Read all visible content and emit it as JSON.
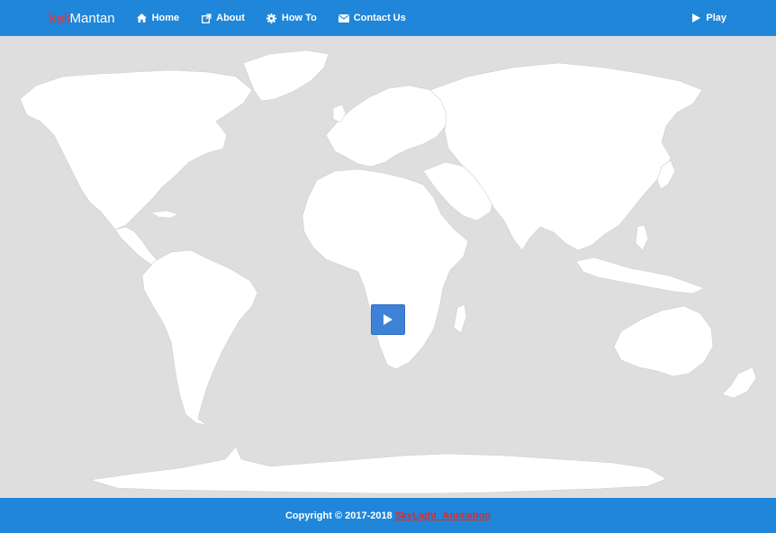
{
  "brand": {
    "accent": "kali",
    "rest": "Mantan"
  },
  "nav": {
    "home": "Home",
    "about": "About",
    "howto": "How To",
    "contact": "Contact Us",
    "play": "Play"
  },
  "footer": {
    "copyright": "Copyright © 2017-2018",
    "credit": "SkyLight_Animation"
  },
  "colors": {
    "bar": "#1f86d9",
    "ocean": "#dedede",
    "land": "#ffffff",
    "accent": "#ff2b2b",
    "play_button": "#3d82d6"
  },
  "icons": {
    "home": "home-icon",
    "about": "external-link-icon",
    "howto": "gear-icon",
    "contact": "envelope-icon",
    "play": "play-icon",
    "center_play": "play-icon"
  }
}
